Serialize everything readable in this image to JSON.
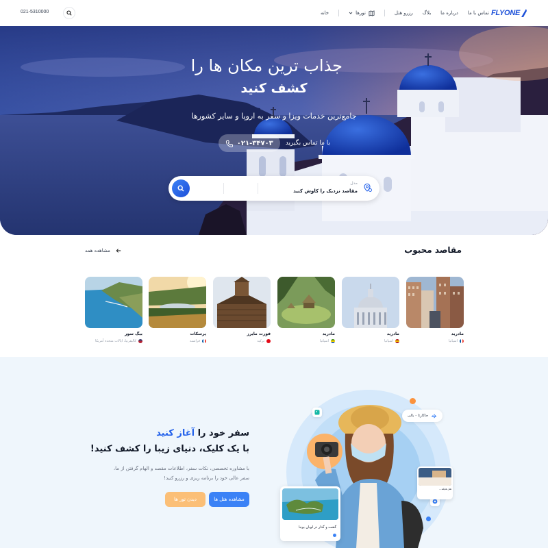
{
  "header": {
    "logo": "FLYONE",
    "nav": [
      "خانه",
      "تورها",
      "رزرو هتل",
      "بلاگ",
      "درباره ما",
      "تماس با ما"
    ],
    "phone": "021-5310000"
  },
  "hero": {
    "title_line1": "جذاب ترین مکان ها را",
    "title_line2": "کشف کنید",
    "subtitle": "جامع‌ترین خدمات ویزا و سفر به اروپا و سایر کشورها",
    "contact_label": "با ما تماس بگیرید",
    "contact_phone": "۰۲۱-۳۴۷۰۳",
    "search": {
      "label": "مدل",
      "value": "مقاصد نزدیک را کاوش کنید"
    }
  },
  "popular": {
    "title": "مقاصد محبوب",
    "view_all": "مشاهده همه",
    "items": [
      {
        "name": "مادرید",
        "country": "اسپانیا",
        "flag_colors": [
          "#0055A4",
          "#EF4135"
        ]
      },
      {
        "name": "مادرید",
        "country": "اسپانیا",
        "flag_colors": [
          "#AA151B",
          "#F1BF00"
        ]
      },
      {
        "name": "مادرید",
        "country": "اسپانیا",
        "flag_colors": [
          "#3C8D0D",
          "#F8D000"
        ]
      },
      {
        "name": "فورت مایرز",
        "country": "ترکیه",
        "flag_colors": [
          "#E30A17",
          "#E30A17"
        ]
      },
      {
        "name": "پرسکات",
        "country": "فرانسه",
        "flag_colors": [
          "#0055A4",
          "#EF4135"
        ]
      },
      {
        "name": "بیگ سور",
        "country": "کالیفرنیا، ایالات متحده آمریکا",
        "flag_colors": [
          "#B22234",
          "#3C3B6E"
        ]
      }
    ]
  },
  "promo": {
    "title_a": "سفر خود را ",
    "title_accent": "آغاز کنید",
    "title_line2": "با یک کلیک، دنیای زیبا را کشف کنید!",
    "description": "با مشاوره تخصصی، نکات سفر، اطلاعات مقصد و الهام گرفتن از ما، سفر عالی خود را برنامه ریزی و رزرو کنید!",
    "btn_hotels": "مشاهده هتل ها",
    "btn_tours": "دیدن تور ها",
    "chip": "جاکارتا - بالی",
    "card_a": "گشت و گذار در لوبان بوجا",
    "card_b": "هتل هایلند..."
  },
  "colors": {
    "brand": "#1b4fd8",
    "accent_blue": "#3b82f6",
    "accent_orange": "#fbbf77"
  }
}
